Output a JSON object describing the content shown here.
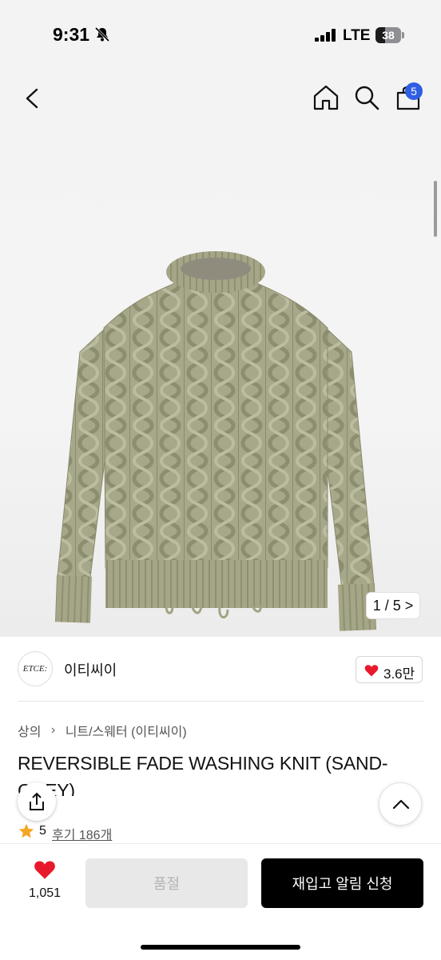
{
  "status_bar": {
    "time": "9:31",
    "network": "LTE",
    "battery": "38"
  },
  "header": {
    "cart_badge": "5",
    "icons": [
      "back-icon",
      "home-icon",
      "search-icon",
      "shopping-bag-icon"
    ]
  },
  "gallery": {
    "counter": "1 / 5 >",
    "current": 1,
    "total": 5
  },
  "seller": {
    "logo_text": "ETCE:",
    "name": "이티씨이",
    "likes": "3.6만"
  },
  "breadcrumb": {
    "root": "상의",
    "category": "니트/스웨터 (이티씨이)"
  },
  "product": {
    "title": "REVERSIBLE FADE WASHING KNIT (SAND-GREY)"
  },
  "rating": {
    "score": "5",
    "reviews": "후기 186개"
  },
  "bottom_bar": {
    "wish_count": "1,051",
    "soldout_label": "품절",
    "restock_label": "재입고 알림 신청"
  },
  "colors": {
    "badge": "#2f5de3",
    "heart": "#e8192c",
    "star": "#f5a623",
    "primary_button": "#000000",
    "sweater": "#a3a384"
  }
}
